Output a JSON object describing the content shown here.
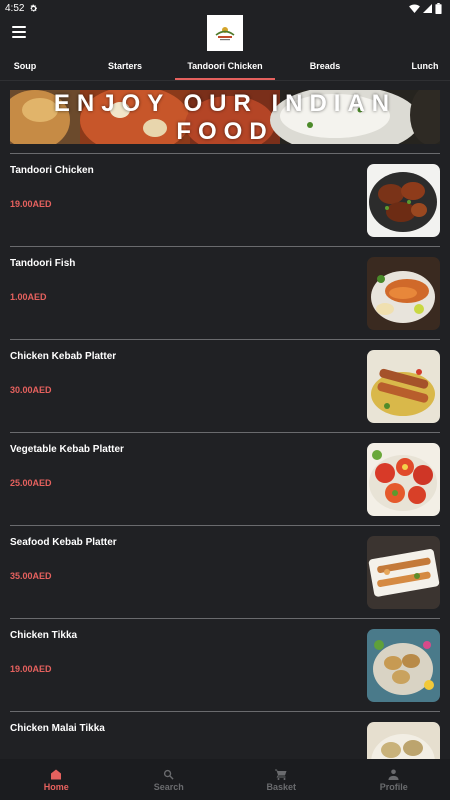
{
  "status": {
    "time": "4:52"
  },
  "tabs": [
    {
      "label": "Soup"
    },
    {
      "label": "Starters"
    },
    {
      "label": "Tandoori Chicken",
      "active": true
    },
    {
      "label": "Breads"
    },
    {
      "label": "Lunch"
    }
  ],
  "banner": {
    "line1": "ENJOY OUR INDIAN",
    "line2": "FOOD"
  },
  "items": [
    {
      "name": "Tandoori Chicken",
      "price": "19.00AED"
    },
    {
      "name": "Tandoori Fish",
      "price": "1.00AED"
    },
    {
      "name": "Chicken Kebab Platter",
      "price": "30.00AED"
    },
    {
      "name": "Vegetable Kebab Platter",
      "price": "25.00AED"
    },
    {
      "name": "Seafood Kebab Platter",
      "price": "35.00AED"
    },
    {
      "name": "Chicken Tikka",
      "price": "19.00AED"
    },
    {
      "name": "Chicken Malai Tikka",
      "price": ""
    }
  ],
  "nav": {
    "home": "Home",
    "search": "Search",
    "basket": "Basket",
    "profile": "Profile"
  },
  "colors": {
    "accent": "#e5615e",
    "background": "#202124",
    "navbar": "#1b1c1f"
  }
}
